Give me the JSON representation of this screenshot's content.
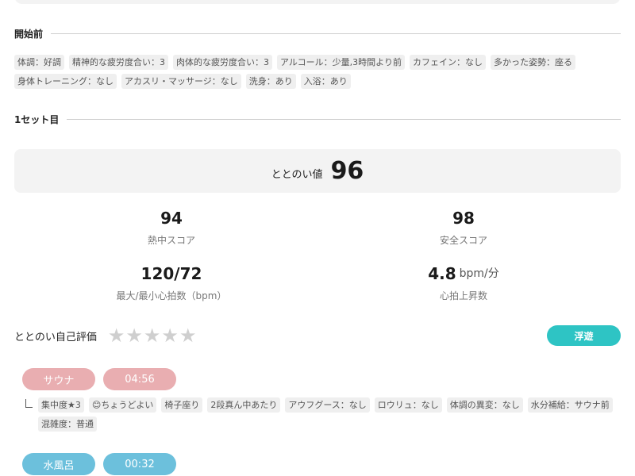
{
  "before": {
    "title": "開始前",
    "tags": [
      "体調：好調",
      "精神的な疲労度合い：3",
      "肉体的な疲労度合い：3",
      "アルコール：少量,3時間より前",
      "カフェイン：なし",
      "多かった姿勢：座る",
      "身体トレーニング：なし",
      "アカスリ・マッサージ：なし",
      "洗身：あり",
      "入浴：あり"
    ]
  },
  "set1": {
    "title": "1セット目",
    "totonoi_label": "ととのい値",
    "totonoi_value": "96",
    "heat_score": "94",
    "heat_label": "熱中スコア",
    "safety_score": "98",
    "safety_label": "安全スコア",
    "max_min_hr": "120/72",
    "max_min_hr_label": "最大/最小心拍数（bpm）",
    "hr_rise": "4.8",
    "hr_rise_unit": "bpm/分",
    "hr_rise_label": "心拍上昇数",
    "self_eval_label": "ととのい自己評価",
    "self_eval_stars": 0,
    "self_eval_max": 5,
    "float_button": "浮遊",
    "sauna_label": "サウナ",
    "sauna_time": "04:56",
    "sauna_tags": [
      "集中度★3",
      "😊ちょうどよい",
      "椅子座り",
      "2段真ん中あたり",
      "アウフグース：なし",
      "ロウリュ：なし",
      "体調の異変：なし",
      "水分補給：サウナ前",
      "混雑度：普通"
    ],
    "water_label": "水風呂",
    "water_time": "00:32"
  },
  "colors": {
    "float_button": "#2ec4c4",
    "sauna_pill": "#e9aeb1",
    "water_pill": "#6cc0dc",
    "star_empty": "#cfcfcf"
  }
}
